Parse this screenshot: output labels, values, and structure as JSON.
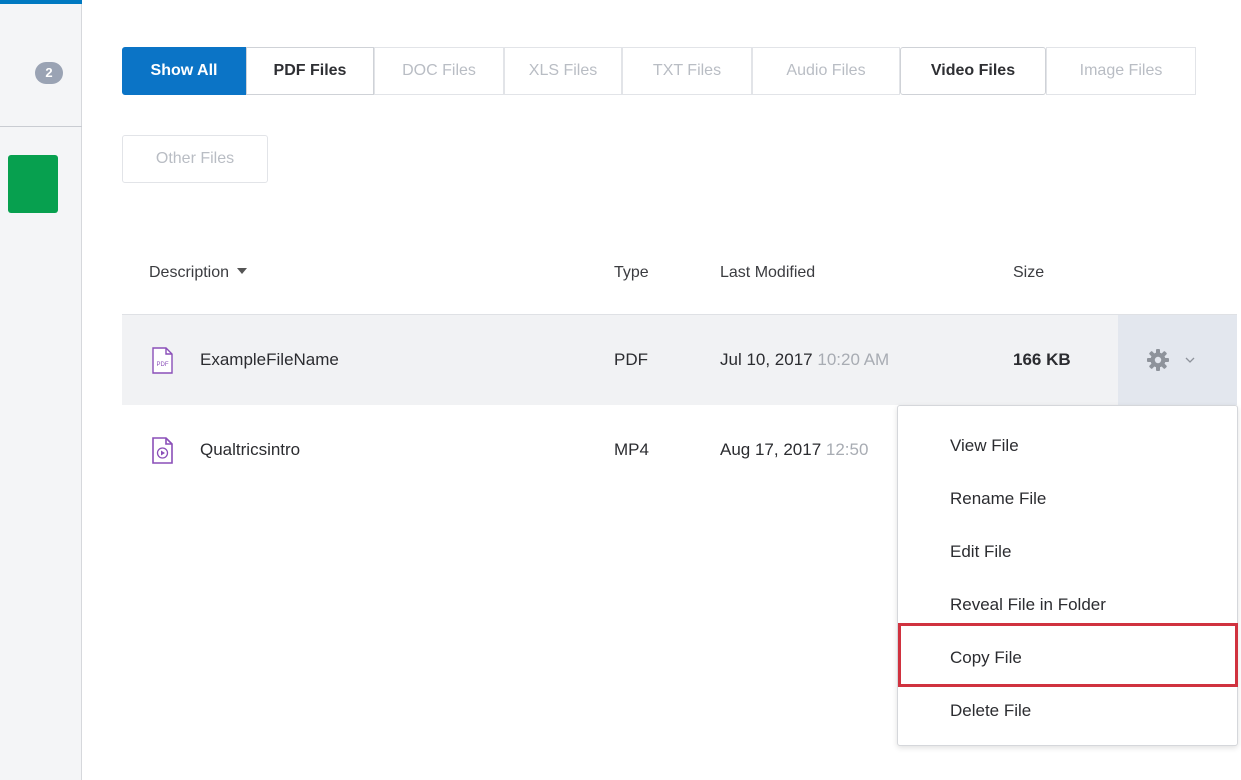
{
  "sidebar": {
    "badge_count": "2"
  },
  "filters": [
    {
      "label": "Show All",
      "state": "active"
    },
    {
      "label": "PDF Files",
      "state": "enabled"
    },
    {
      "label": "DOC Files",
      "state": "disabled"
    },
    {
      "label": "XLS Files",
      "state": "disabled"
    },
    {
      "label": "TXT Files",
      "state": "disabled"
    },
    {
      "label": "Audio Files",
      "state": "disabled"
    },
    {
      "label": "Video Files",
      "state": "enabled"
    },
    {
      "label": "Image Files",
      "state": "disabled"
    },
    {
      "label": "Other Files",
      "state": "disabled"
    }
  ],
  "table": {
    "headers": {
      "description": "Description",
      "type": "Type",
      "last_modified": "Last Modified",
      "size": "Size"
    },
    "rows": [
      {
        "name": "ExampleFileName",
        "icon": "pdf-file-icon",
        "type": "PDF",
        "date": "Jul 10, 2017",
        "time": "10:20 AM",
        "size": "166 KB"
      },
      {
        "name": "Qualtricsintro",
        "icon": "video-file-icon",
        "type": "MP4",
        "date": "Aug 17, 2017",
        "time": "12:50"
      }
    ]
  },
  "menu": {
    "items": [
      "View File",
      "Rename File",
      "Edit File",
      "Reveal File in Folder",
      "Copy File",
      "Delete File"
    ],
    "highlighted": "Copy File"
  },
  "colors": {
    "accent": "#0b74c6",
    "highlight_border": "#d0323f",
    "icon_purple": "#8a4fb8",
    "sidebar_green": "#07a04f"
  }
}
